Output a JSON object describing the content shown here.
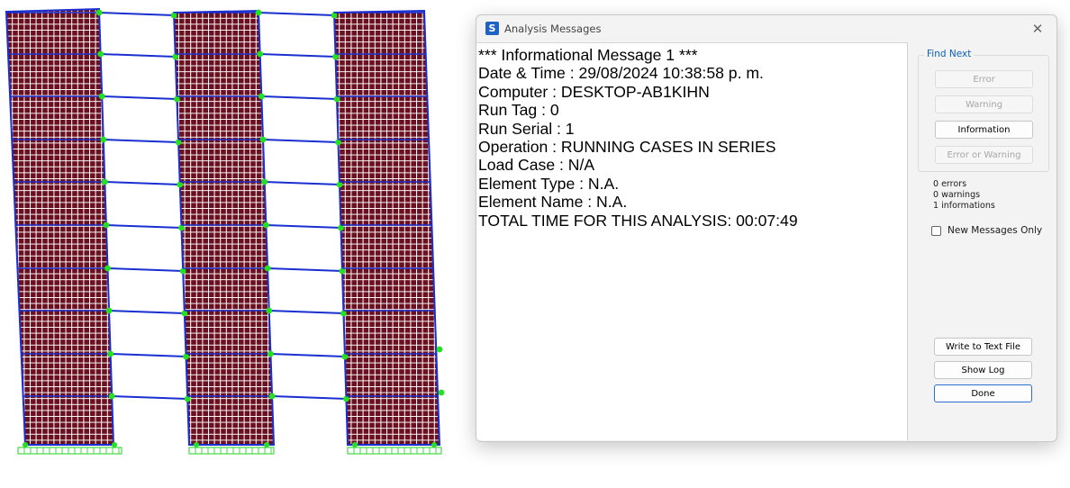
{
  "model_view": {
    "description_icon": "structural-frame-model",
    "colors": {
      "shell_mesh": "#6a1020",
      "beams": "#1a2fd0",
      "joints": "#22e022",
      "supports": "#44d844",
      "mesh_lines": "#ffffff"
    }
  },
  "dialog": {
    "app_icon_letter": "S",
    "title": "Analysis Messages",
    "close_glyph": "✕",
    "messages": [
      "*** Informational Message 1 ***",
      "Date & Time : 29/08/2024 10:38:58 p. m.",
      "Computer : DESKTOP-AB1KIHN",
      "Run Tag : 0",
      "Run Serial : 1",
      "Operation : RUNNING CASES IN SERIES",
      "Load Case : N/A",
      "Element Type : N.A.",
      "Element Name : N.A.",
      "TOTAL TIME FOR THIS ANALYSIS: 00:07:49"
    ],
    "find_next": {
      "label": "Find Next",
      "error": "Error",
      "warning": "Warning",
      "information": "Information",
      "error_or_warning": "Error or Warning"
    },
    "counts": {
      "errors": "0 errors",
      "warnings": "0 warnings",
      "informations": "1 informations"
    },
    "new_messages_only": {
      "label": "New Messages Only",
      "checked": false
    },
    "buttons": {
      "write": "Write to Text File",
      "show_log": "Show Log",
      "done": "Done"
    }
  }
}
